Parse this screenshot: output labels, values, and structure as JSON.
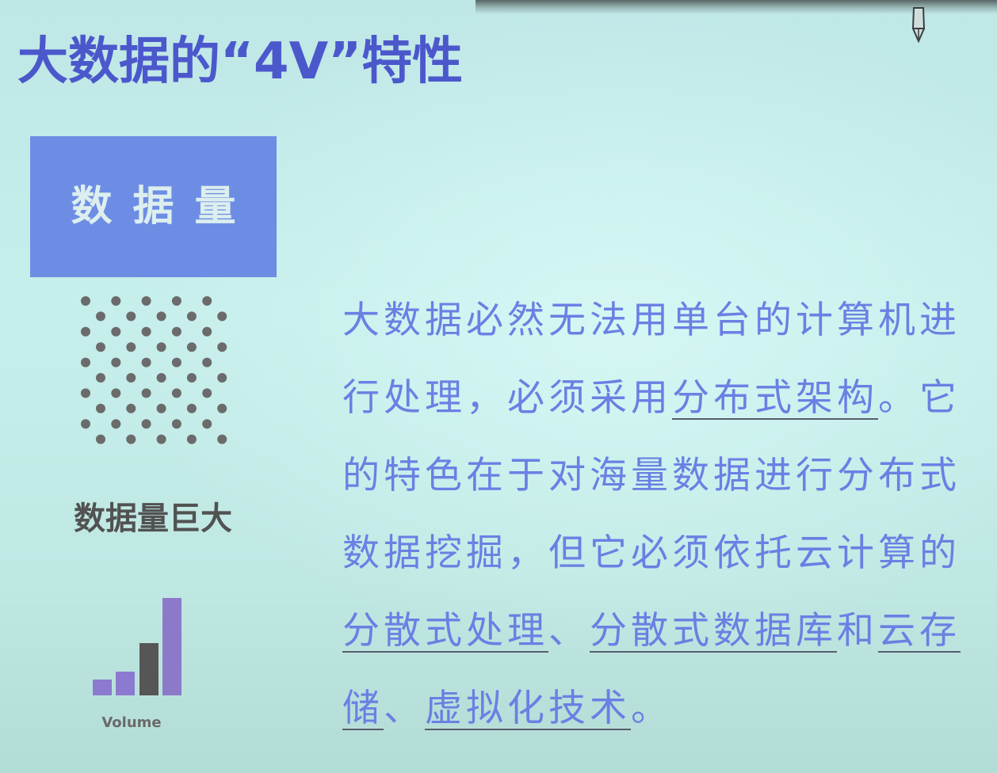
{
  "title": "大数据的“4V”特性",
  "card": {
    "label": "数据量"
  },
  "dot_grid": {
    "icon_name": "dot-grid-icon"
  },
  "caption": "数据量巨大",
  "icon": {
    "name": "bar-chart-icon",
    "label": "Volume"
  },
  "body": {
    "lines": [
      [
        {
          "text": "大数据必然无法用单台的计算机进",
          "underline": false
        }
      ],
      [
        {
          "text": "行处理，必须采用",
          "underline": false
        },
        {
          "text": "分布式架构",
          "underline": true
        },
        {
          "text": "。它",
          "underline": false
        }
      ],
      [
        {
          "text": "的特色在于对海量数据进行分布式",
          "underline": false
        }
      ],
      [
        {
          "text": "数据挖掘，但它必须依托云计算的",
          "underline": false
        }
      ],
      [
        {
          "text": "分散式处理",
          "underline": true
        },
        {
          "text": "、",
          "underline": false
        },
        {
          "text": "分散式数据库",
          "underline": true
        },
        {
          "text": "和",
          "underline": false
        },
        {
          "text": "云存",
          "underline": true
        }
      ],
      [
        {
          "text": "储",
          "underline": true
        },
        {
          "text": "、",
          "underline": false
        },
        {
          "text": "虚拟化技术",
          "underline": true
        },
        {
          "text": "。",
          "underline": false
        }
      ]
    ]
  },
  "colors": {
    "title": "#4b58cc",
    "card_background": "#6d8de5",
    "card_text": "#dcefee",
    "body_text": "#6a80e3",
    "dots": "#6b6b6b",
    "bar_purple": "#8c7ad0",
    "bar_gray": "#565656"
  }
}
